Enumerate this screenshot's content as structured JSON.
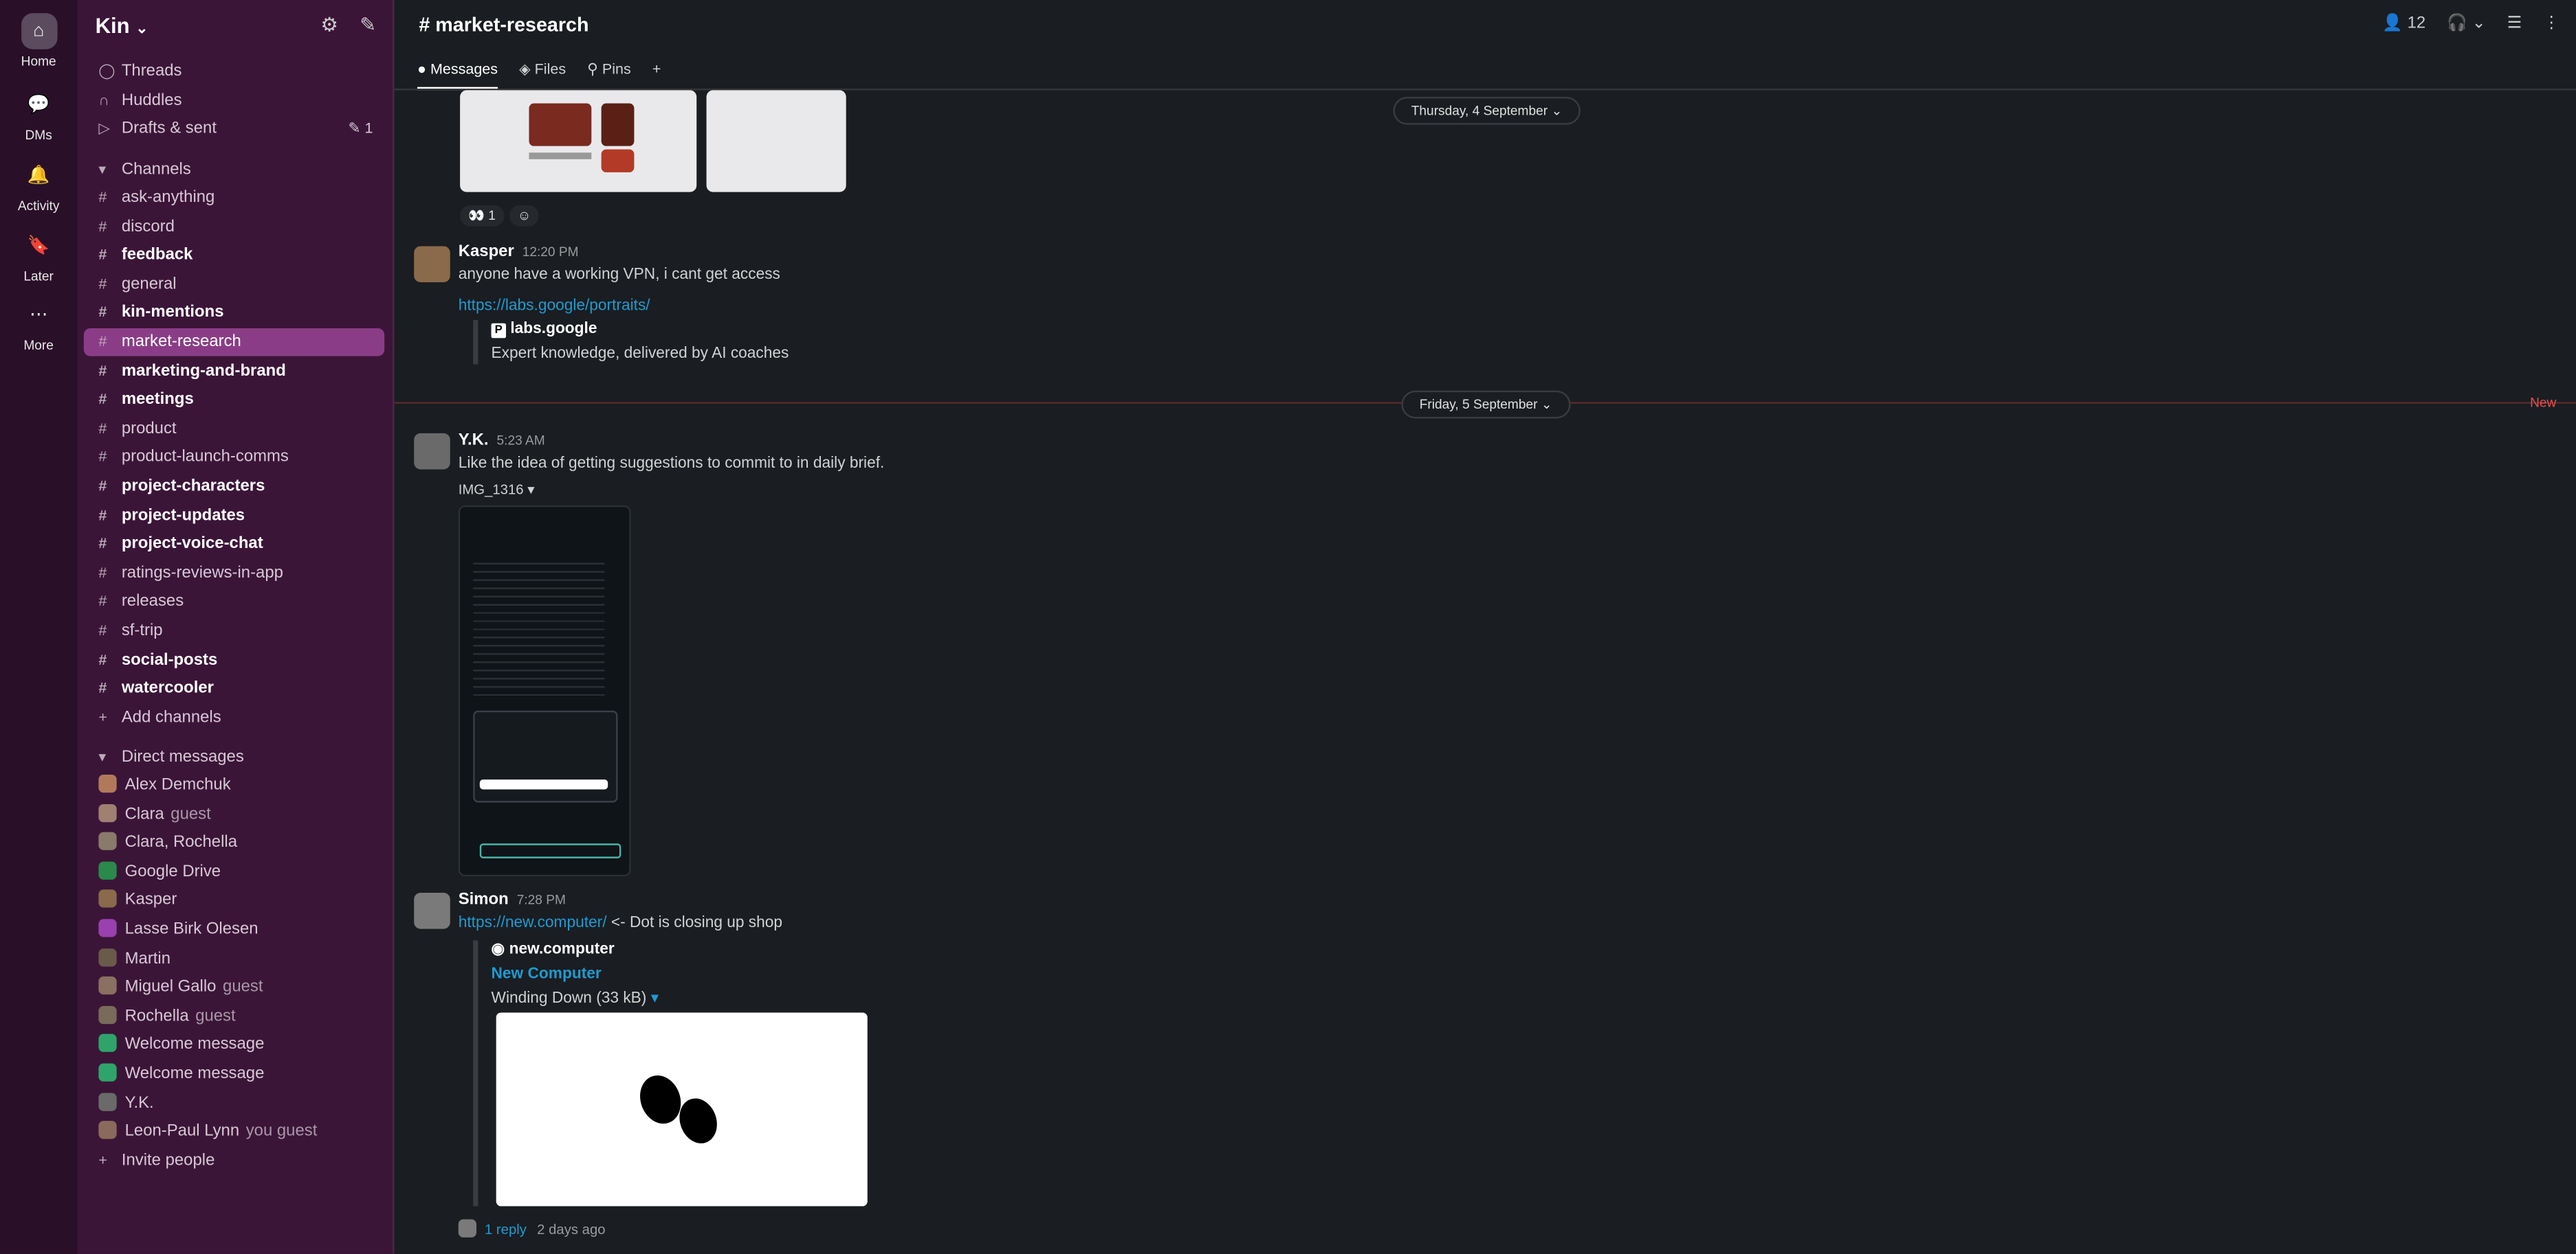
{
  "rail": {
    "items": [
      {
        "label": "Home",
        "icon": "home-icon"
      },
      {
        "label": "DMs",
        "icon": "dms-icon"
      },
      {
        "label": "Activity",
        "icon": "bell-icon"
      },
      {
        "label": "Later",
        "icon": "bookmark-icon"
      },
      {
        "label": "More",
        "icon": "more-icon"
      }
    ]
  },
  "workspace": {
    "name": "Kin"
  },
  "sidebar": {
    "top": [
      {
        "label": "Threads",
        "icon": "threads-icon"
      },
      {
        "label": "Huddles",
        "icon": "headphones-icon"
      },
      {
        "label": "Drafts & sent",
        "icon": "send-icon",
        "badge": "1"
      }
    ],
    "channels_header": "Channels",
    "channels": [
      {
        "label": "ask-anything",
        "bold": false
      },
      {
        "label": "discord",
        "bold": false
      },
      {
        "label": "feedback",
        "bold": true
      },
      {
        "label": "general",
        "bold": false
      },
      {
        "label": "kin-mentions",
        "bold": true
      },
      {
        "label": "market-research",
        "bold": false,
        "active": true
      },
      {
        "label": "marketing-and-brand",
        "bold": true
      },
      {
        "label": "meetings",
        "bold": true
      },
      {
        "label": "product",
        "bold": false
      },
      {
        "label": "product-launch-comms",
        "bold": false
      },
      {
        "label": "project-characters",
        "bold": true
      },
      {
        "label": "project-updates",
        "bold": true
      },
      {
        "label": "project-voice-chat",
        "bold": true
      },
      {
        "label": "ratings-reviews-in-app",
        "bold": false
      },
      {
        "label": "releases",
        "bold": false
      },
      {
        "label": "sf-trip",
        "bold": false
      },
      {
        "label": "social-posts",
        "bold": true
      },
      {
        "label": "watercooler",
        "bold": true
      }
    ],
    "add_channels": "Add channels",
    "dm_header": "Direct messages",
    "dms": [
      {
        "label": "Alex Demchuk",
        "tag": ""
      },
      {
        "label": "Clara",
        "tag": "guest"
      },
      {
        "label": "Clara, Rochella",
        "tag": ""
      },
      {
        "label": "Google Drive",
        "tag": ""
      },
      {
        "label": "Kasper",
        "tag": ""
      },
      {
        "label": "Lasse Birk Olesen",
        "tag": ""
      },
      {
        "label": "Martin",
        "tag": ""
      },
      {
        "label": "Miguel Gallo",
        "tag": "guest"
      },
      {
        "label": "Rochella",
        "tag": "guest"
      },
      {
        "label": "Welcome message",
        "tag": ""
      },
      {
        "label": "Welcome message",
        "tag": ""
      },
      {
        "label": "Y.K.",
        "tag": ""
      },
      {
        "label": "Leon-Paul Lynn",
        "tag": "you  guest"
      }
    ],
    "invite": "Invite people"
  },
  "header": {
    "channel": "market-research",
    "member_count": "12",
    "tabs": [
      "Messages",
      "Files",
      "Pins"
    ]
  },
  "messages": {
    "date1": "Thursday, 4 September",
    "date2": "Friday, 5 September",
    "new_label": "New",
    "reaction": "1",
    "kasper": {
      "author": "Kasper",
      "time": "12:20 PM",
      "text": "anyone have a working VPN, i cant get access",
      "link": "https://labs.google/portraits/",
      "unfurl_site": "labs.google",
      "unfurl_desc": "Expert knowledge, delivered by AI coaches"
    },
    "yk": {
      "author": "Y.K.",
      "time": "5:23 AM",
      "text": "Like the idea of getting suggestions to commit to in daily brief.",
      "file": "IMG_1316"
    },
    "simon": {
      "author": "Simon",
      "time": "7:28 PM",
      "link": "https://new.computer/",
      "text": " <- Dot is closing up shop",
      "unfurl_site": "new.computer",
      "unfurl_title": "New Computer",
      "unfurl_file": "Winding Down (33 kB)",
      "replies": "1 reply",
      "reply_time": "2 days ago"
    }
  }
}
